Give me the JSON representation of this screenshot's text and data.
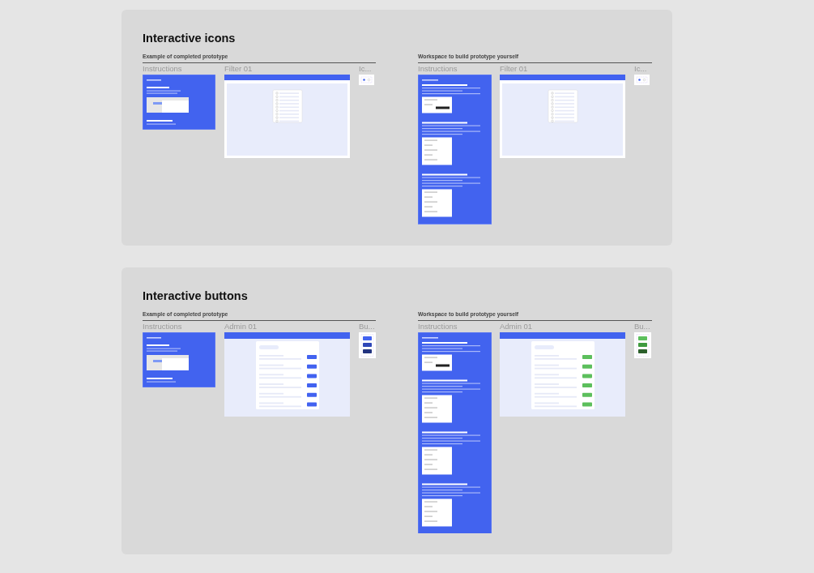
{
  "sections": [
    {
      "kind": "icons",
      "title": "Interactive icons",
      "panels": [
        {
          "kind": "example",
          "heading": "Example of completed prototype",
          "frames": [
            {
              "kind": "instructions",
              "label": "Instructions"
            },
            {
              "kind": "screen",
              "label": "Filter 01"
            },
            {
              "kind": "variants",
              "label": "Ic..."
            }
          ]
        },
        {
          "kind": "workspace",
          "heading": "Workspace to build prototype yourself",
          "frames": [
            {
              "kind": "instructions",
              "label": "Instructions"
            },
            {
              "kind": "screen",
              "label": "Filter 01"
            },
            {
              "kind": "variants",
              "label": "Ic..."
            }
          ]
        }
      ]
    },
    {
      "kind": "buttons",
      "title": "Interactive buttons",
      "panels": [
        {
          "kind": "example",
          "heading": "Example of completed prototype",
          "frames": [
            {
              "kind": "instructions",
              "label": "Instructions"
            },
            {
              "kind": "screen",
              "label": "Admin 01"
            },
            {
              "kind": "variants",
              "label": "Bu..."
            }
          ]
        },
        {
          "kind": "workspace",
          "heading": "Workspace to build prototype yourself",
          "frames": [
            {
              "kind": "instructions",
              "label": "Instructions"
            },
            {
              "kind": "screen",
              "label": "Admin 01"
            },
            {
              "kind": "variants",
              "label": "Bu..."
            }
          ]
        }
      ]
    }
  ]
}
